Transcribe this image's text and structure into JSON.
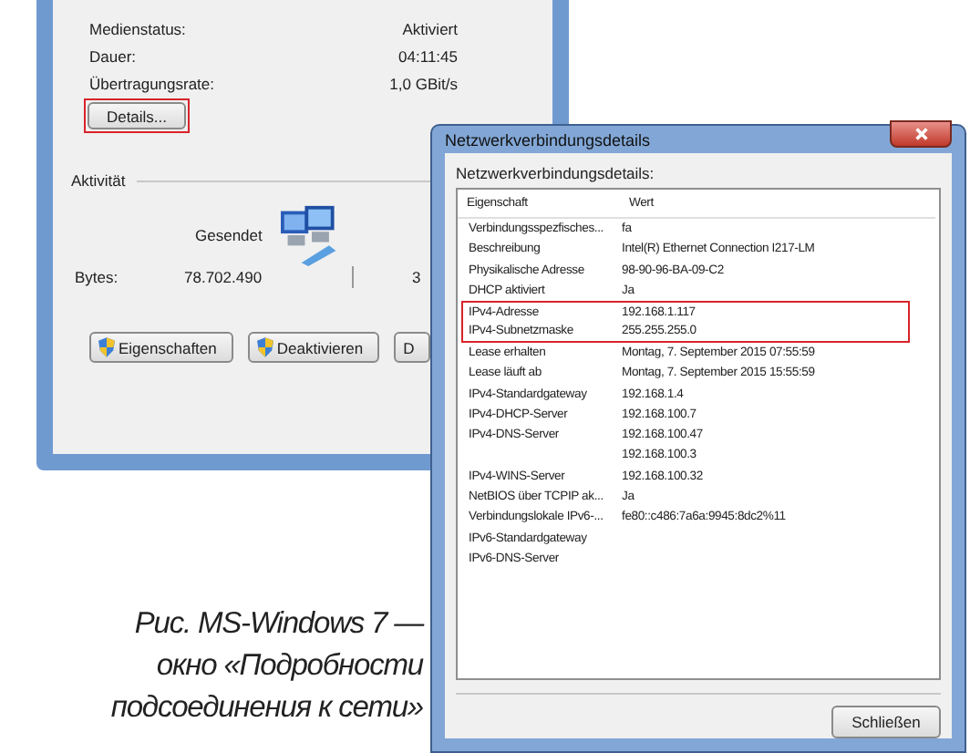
{
  "status_window": {
    "rows": [
      {
        "label": "Medienstatus:",
        "value": "Aktiviert"
      },
      {
        "label": "Dauer:",
        "value": "04:11:45"
      },
      {
        "label": "Übertragungsrate:",
        "value": "1,0 GBit/s"
      }
    ],
    "details_button": {
      "label": "Details...",
      "highlighted": true
    },
    "activity": {
      "title": "Aktivität",
      "sent_label": "Gesendet",
      "bytes_label": "Bytes:",
      "bytes_sent": "78.702.490",
      "bytes_received": "3"
    },
    "buttons": [
      {
        "label": "Eigenschaften",
        "kind": "shield"
      },
      {
        "label": "Deaktivieren",
        "kind": "shield"
      },
      {
        "label": "D",
        "kind": "plain"
      }
    ]
  },
  "details_window": {
    "title": "Netzwerkverbindungsdetails",
    "list_label": "Netzwerkverbindungsdetails:",
    "columns": [
      "Eigenschaft",
      "Wert"
    ],
    "rows": [
      {
        "property": "Verbindungsspezfisches...",
        "value": "fa",
        "highlighted": false
      },
      {
        "property": "Beschreibung",
        "value": "Intel(R) Ethernet Connection I217-LM",
        "highlighted": false
      },
      {
        "property": "Physikalische Adresse",
        "value": "98-90-96-BA-09-C2",
        "highlighted": false
      },
      {
        "property": "DHCP aktiviert",
        "value": "Ja",
        "highlighted": false
      },
      {
        "property": "IPv4-Adresse",
        "value": "192.168.1.117",
        "highlighted": true
      },
      {
        "property": "IPv4-Subnetzmaske",
        "value": "255.255.255.0",
        "highlighted": true
      },
      {
        "property": "Lease erhalten",
        "value": "Montag, 7. September 2015 07:55:59",
        "highlighted": false
      },
      {
        "property": "Lease läuft ab",
        "value": "Montag, 7. September 2015 15:55:59",
        "highlighted": false
      },
      {
        "property": "IPv4-Standardgateway",
        "value": "192.168.1.4",
        "highlighted": false
      },
      {
        "property": "IPv4-DHCP-Server",
        "value": "192.168.100.7",
        "highlighted": false
      },
      {
        "property": "IPv4-DNS-Server",
        "value": "192.168.100.47",
        "highlighted": false
      },
      {
        "value": "192.168.100.3",
        "highlighted": false
      },
      {
        "property": "IPv4-WINS-Server",
        "value": "192.168.100.32",
        "highlighted": false
      },
      {
        "property": "NetBIOS über TCPIP ak...",
        "value": "Ja",
        "highlighted": false
      },
      {
        "property": "Verbindungslokale IPv6-...",
        "value": "fe80::c486:7a6a:9945:8dc2%11",
        "highlighted": false
      },
      {
        "property": "IPv6-Standardgateway",
        "highlighted": false
      },
      {
        "property": "IPv6-DNS-Server",
        "highlighted": false
      }
    ],
    "close_button": "Schließen"
  },
  "caption": [
    "Рис. MS-Windows 7 —",
    "окно «Подробности",
    "подсоединения к сети»"
  ]
}
